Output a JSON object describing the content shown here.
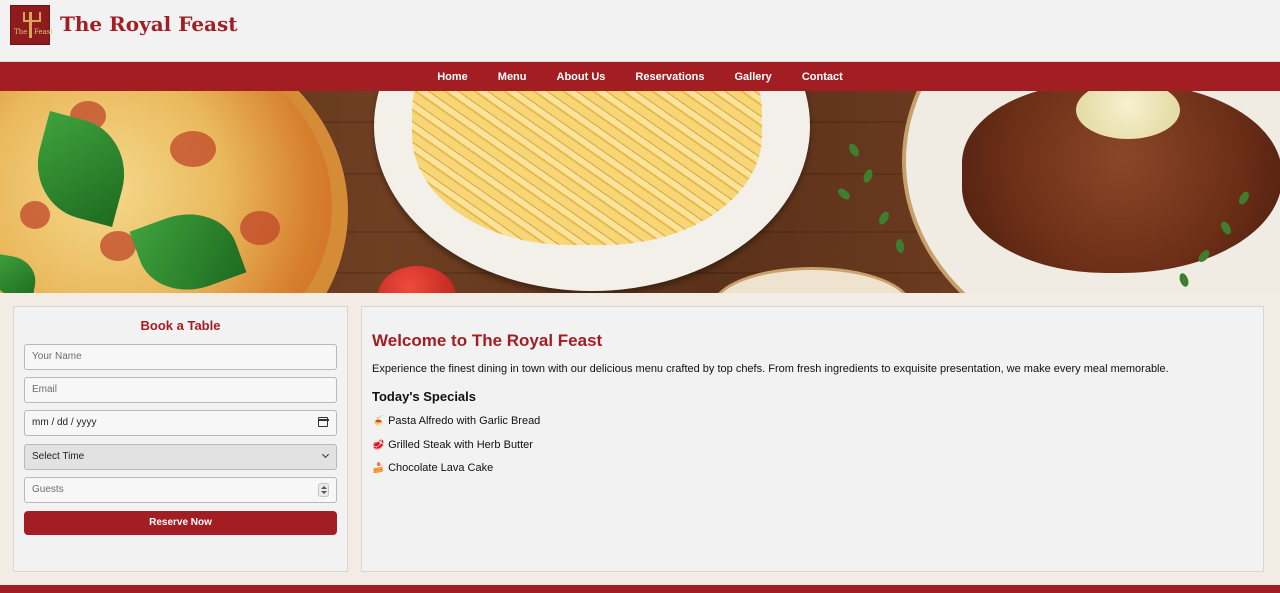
{
  "header": {
    "brand": "The Royal Feast",
    "logo_text_left": "The",
    "logo_text_right": "Feast",
    "logo_icon": "fork-icon"
  },
  "nav": {
    "items": [
      "Home",
      "Menu",
      "About Us",
      "Reservations",
      "Gallery",
      "Contact"
    ]
  },
  "hero": {
    "description": "banner-image"
  },
  "booking": {
    "title": "Book a Table",
    "name_placeholder": "Your Name",
    "email_placeholder": "Email",
    "date_value": "mm / dd / yyyy",
    "time_value": "Select Time",
    "guests_placeholder": "Guests",
    "reserve_label": "Reserve Now"
  },
  "welcome": {
    "title": "Welcome to The Royal Feast",
    "text": "Experience the finest dining in town with our delicious menu crafted by top chefs. From fresh ingredients to exquisite presentation, we make every meal memorable.",
    "specials_title": "Today's Specials",
    "specials": [
      {
        "icon": "🍝",
        "label": "Pasta Alfredo with Garlic Bread"
      },
      {
        "icon": "🥩",
        "label": "Grilled Steak with Herb Butter"
      },
      {
        "icon": "🍰",
        "label": "Chocolate Lava Cake"
      }
    ]
  },
  "colors": {
    "brand": "#a31e22",
    "panel": "#f2f2f2",
    "page_bg": "#f3ece4"
  }
}
